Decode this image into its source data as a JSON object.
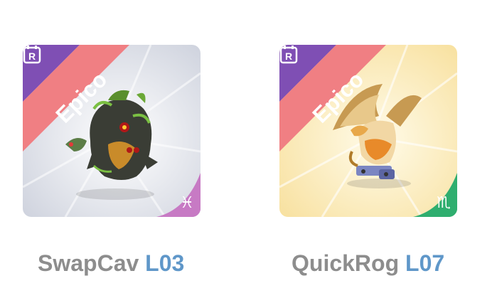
{
  "cards": [
    {
      "rarity": "Epico",
      "badge": "R",
      "zodiac_icon": "pisces-icon",
      "zodiac_symbol": "♓",
      "name": "SwapCav",
      "level": "L03",
      "background": "#d9dce6",
      "zodiac_color": "#c77ac4"
    },
    {
      "rarity": "Epico",
      "badge": "R",
      "zodiac_icon": "scorpio-icon",
      "zodiac_symbol": "♏",
      "name": "QuickRog",
      "level": "L07",
      "background": "#fbe7ae",
      "zodiac_color": "#2fae6f"
    }
  ],
  "colors": {
    "rarity_banner": "#f07f83",
    "corner_purple": "#7f4fb4",
    "name_text": "#8d8d8d",
    "level_text": "#5f97c9"
  }
}
